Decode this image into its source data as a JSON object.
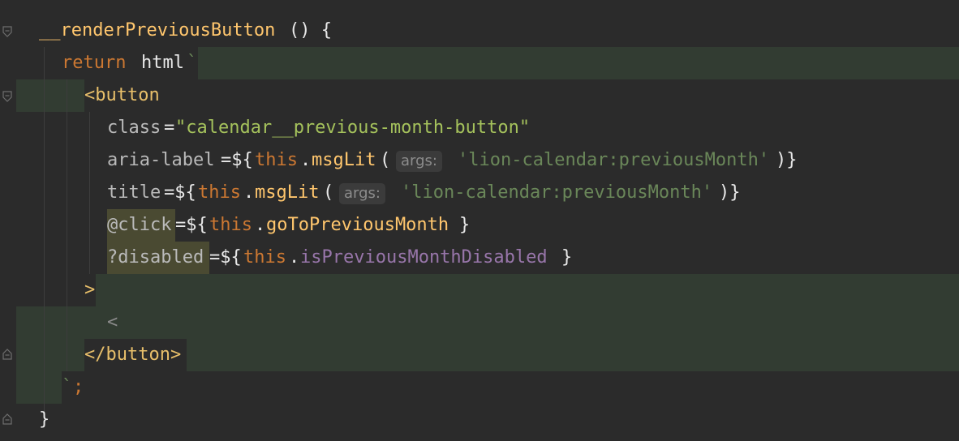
{
  "code": {
    "line1": {
      "method": "__renderPreviousButton",
      "rest": "() {"
    },
    "line2": {
      "keyword": "return",
      "tagfn": "html",
      "backtick": "`"
    },
    "line3": {
      "tag": "<button"
    },
    "line4": {
      "attr": "class",
      "eq": "=",
      "value": "\"calendar__previous-month-button\""
    },
    "line5": {
      "attr": "aria-label",
      "open": "=${",
      "this": "this",
      "dot": ".",
      "call": "msgLit",
      "paren": "(",
      "hint": "args:",
      "arg": "'lion-calendar:previousMonth'",
      "close": ")}"
    },
    "line6": {
      "attr": "title",
      "open": "=${",
      "this": "this",
      "dot": ".",
      "call": "msgLit",
      "paren": "(",
      "hint": "args:",
      "arg": "'lion-calendar:previousMonth'",
      "close": ")}"
    },
    "line7": {
      "attr": "@click",
      "open": "=${",
      "this": "this",
      "dot": ".",
      "member": "goToPreviousMonth",
      "close": "}"
    },
    "line8": {
      "attr": "?disabled",
      "open": "=${",
      "this": "this",
      "dot": ".",
      "prop": "isPreviousMonthDisabled",
      "close": "}"
    },
    "line9": {
      "text": ">"
    },
    "line10": {
      "text": "<"
    },
    "line11": {
      "tag": "</button>"
    },
    "line12": {
      "backtick": "`",
      "semi": ";"
    },
    "line13": {
      "text": "}"
    }
  },
  "colors": {
    "background": "#2b2b2b",
    "keyword": "#cc7832",
    "function": "#ffc66d",
    "string": "#6a8759",
    "property": "#9876aa",
    "injected_bg": "#323c32"
  }
}
